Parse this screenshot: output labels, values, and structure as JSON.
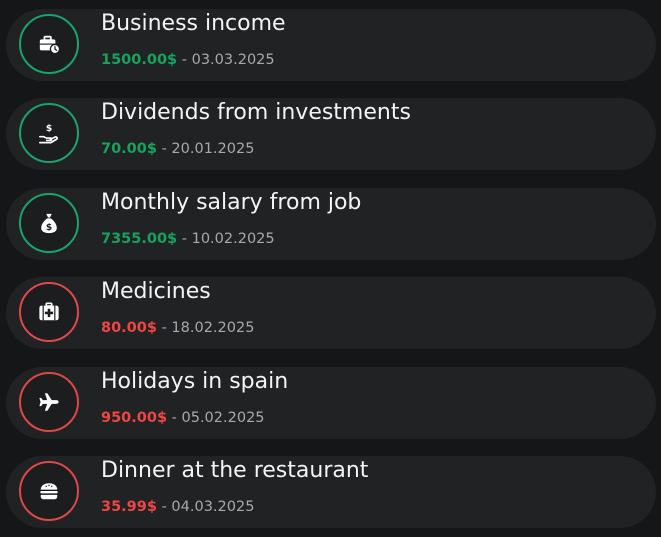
{
  "colors": {
    "income": "#16a35d",
    "expense": "#ef4545",
    "row_background": "#202224",
    "page_background": "#151617"
  },
  "transactions": [
    {
      "title": "Business income",
      "amount": "1500.00$",
      "separator": " - ",
      "date": "03.03.2025",
      "kind": "income",
      "icon": "briefcase-clock-icon"
    },
    {
      "title": "Dividends from investments",
      "amount": "70.00$",
      "separator": " - ",
      "date": "20.01.2025",
      "kind": "income",
      "icon": "hand-dollar-icon"
    },
    {
      "title": "Monthly salary from job",
      "amount": "7355.00$",
      "separator": " - ",
      "date": "10.02.2025",
      "kind": "income",
      "icon": "money-bag-icon"
    },
    {
      "title": "Medicines",
      "amount": "80.00$",
      "separator": " - ",
      "date": "18.02.2025",
      "kind": "expense",
      "icon": "medical-kit-icon"
    },
    {
      "title": "Holidays in spain",
      "amount": "950.00$",
      "separator": " - ",
      "date": "05.02.2025",
      "kind": "expense",
      "icon": "airplane-icon"
    },
    {
      "title": "Dinner at the restaurant",
      "amount": "35.99$",
      "separator": " - ",
      "date": "04.03.2025",
      "kind": "expense",
      "icon": "burger-icon"
    }
  ]
}
